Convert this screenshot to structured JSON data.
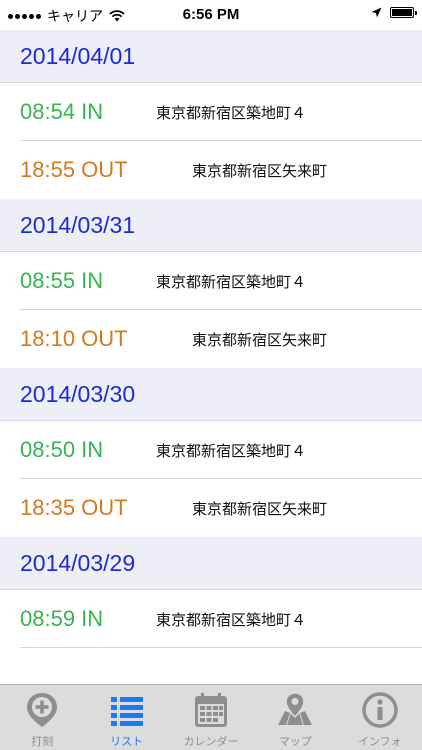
{
  "status_bar": {
    "carrier": "キャリア",
    "time": "6:56 PM"
  },
  "colors": {
    "date_text": "#1c2bd6",
    "in_text": "#36b551",
    "out_text": "#d47a1c",
    "active_tab": "#1a7cf4",
    "inactive_tab": "#8e8e8e"
  },
  "days": [
    {
      "date": "2014/04/01",
      "in": {
        "time": "08:54 IN",
        "place": "東京都新宿区築地町４"
      },
      "out": {
        "time": "18:55 OUT",
        "place": "東京都新宿区矢来町"
      }
    },
    {
      "date": "2014/03/31",
      "in": {
        "time": "08:55 IN",
        "place": "東京都新宿区築地町４"
      },
      "out": {
        "time": "18:10 OUT",
        "place": "東京都新宿区矢来町"
      }
    },
    {
      "date": "2014/03/30",
      "in": {
        "time": "08:50 IN",
        "place": "東京都新宿区築地町４"
      },
      "out": {
        "time": "18:35 OUT",
        "place": "東京都新宿区矢来町"
      }
    },
    {
      "date": "2014/03/29",
      "in": {
        "time": "08:59 IN",
        "place": "東京都新宿区築地町４"
      }
    }
  ],
  "tabs": [
    {
      "label": "打刻",
      "icon": "plus-pin-icon",
      "active": false
    },
    {
      "label": "リスト",
      "icon": "list-icon",
      "active": true
    },
    {
      "label": "カレンダー",
      "icon": "calendar-icon",
      "active": false
    },
    {
      "label": "マップ",
      "icon": "map-icon",
      "active": false
    },
    {
      "label": "インフォ",
      "icon": "info-icon",
      "active": false
    }
  ]
}
